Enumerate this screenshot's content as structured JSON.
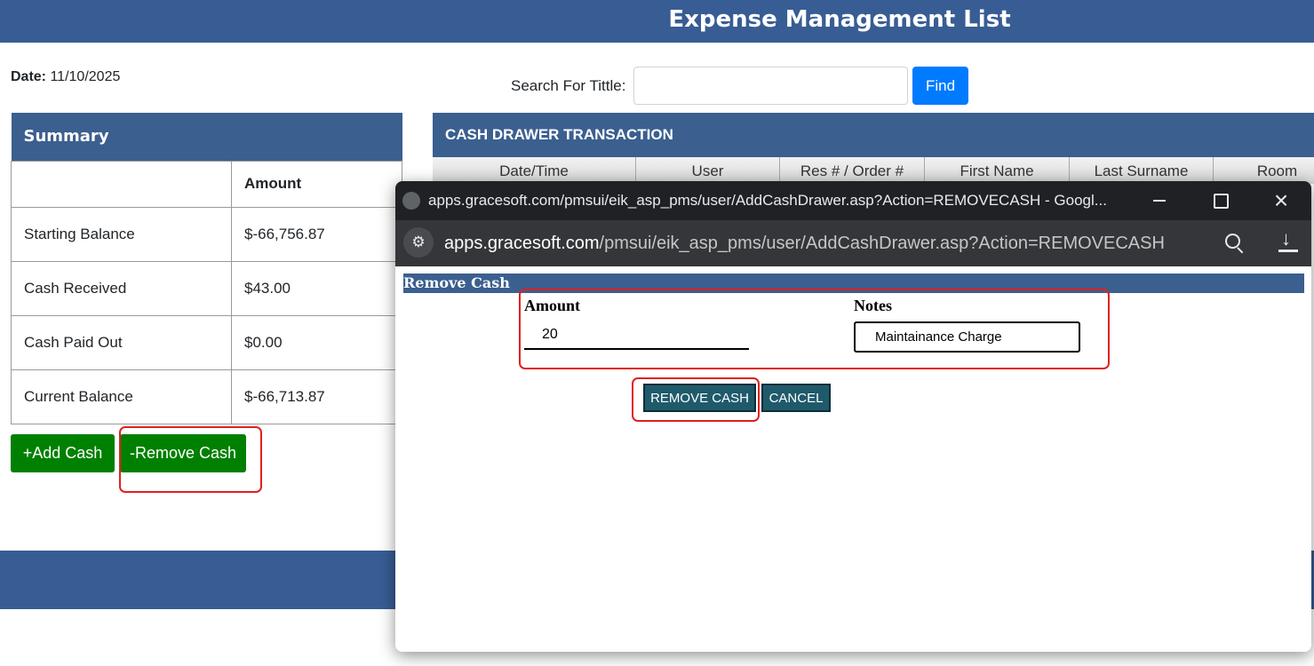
{
  "header": {
    "title": "Expense Management List"
  },
  "date": {
    "label": "Date:",
    "value": "11/10/2025"
  },
  "search": {
    "label": "Search For Tittle:",
    "value": "",
    "find_label": "Find"
  },
  "summary": {
    "title": "Summary",
    "amount_header": "Amount",
    "rows": [
      {
        "label": "Starting Balance",
        "value": "$-66,756.87"
      },
      {
        "label": "Cash Received",
        "value": "$43.00"
      },
      {
        "label": "Cash Paid Out",
        "value": "$0.00"
      },
      {
        "label": "Current Balance",
        "value": "$-66,713.87"
      }
    ]
  },
  "actions": {
    "add_cash": "+Add Cash",
    "remove_cash": "-Remove Cash"
  },
  "cash_drawer": {
    "title": "CASH DRAWER TRANSACTION",
    "columns": [
      "Date/Time",
      "User",
      "Res # / Order #",
      "First Name",
      "Last Surname",
      "Room"
    ]
  },
  "popup": {
    "window_title": "apps.gracesoft.com/pmsui/eik_asp_pms/user/AddCashDrawer.asp?Action=REMOVECASH - Googl...",
    "url_host": "apps.gracesoft.com",
    "url_path": "/pmsui/eik_asp_pms/user/AddCashDrawer.asp?Action=REMOVECASH",
    "form": {
      "header": "Remove Cash",
      "amount_label": "Amount",
      "amount_value": "20",
      "notes_label": "Notes",
      "notes_value": "Maintainance Charge",
      "submit_label": "REMOVE CASH",
      "cancel_label": "CANCEL"
    }
  },
  "colors": {
    "header_blue": "#385d94",
    "panel_blue": "#3b5f8f",
    "find_blue": "#007bff",
    "action_green": "#008000",
    "popup_button_teal": "#1f5a6b",
    "highlight_red": "#e02020"
  }
}
